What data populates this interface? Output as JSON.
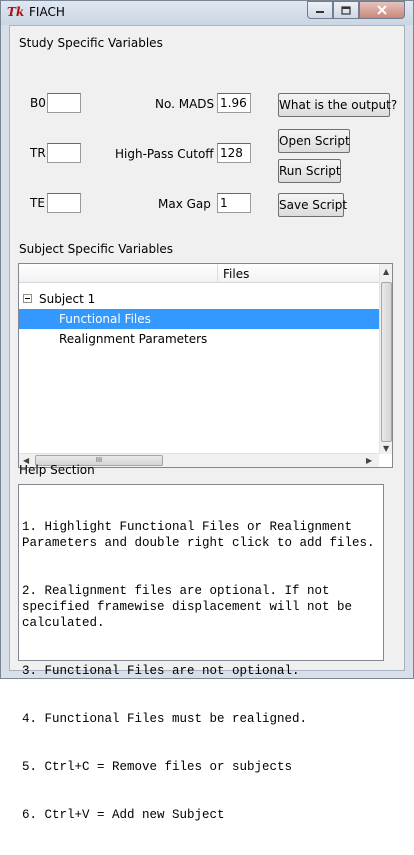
{
  "window": {
    "icon_text": "Tk",
    "title": "FIACH"
  },
  "study": {
    "section_label": "Study Specific Variables",
    "b0_label": "B0",
    "b0_value": "",
    "tr_label": "TR",
    "tr_value": "",
    "te_label": "TE",
    "te_value": "",
    "mads_label": "No. MADS",
    "mads_value": "1.96",
    "highpass_label": "High-Pass Cutoff",
    "highpass_value": "128",
    "maxgap_label": "Max Gap",
    "maxgap_value": "1"
  },
  "buttons": {
    "what_output": "What is the output?",
    "open_script": "Open Script",
    "run_script": "Run Script",
    "save_script": "Save Script"
  },
  "subject": {
    "section_label": "Subject Specific Variables",
    "column_header": "Files",
    "rows": [
      {
        "label": "Subject 1"
      },
      {
        "label": "Functional Files"
      },
      {
        "label": "Realignment Parameters"
      }
    ],
    "scroll_grip": "III"
  },
  "help": {
    "section_label": "Help Section",
    "lines": [
      "1. Highlight Functional Files or Realignment Parameters and double right click to add files.",
      "2. Realignment files are optional. If not specified framewise displacement will not be calculated.",
      "3. Functional Files are not optional.",
      "4. Functional Files must be realigned.",
      "5. Ctrl+C = Remove files or subjects",
      "6. Ctrl+V = Add new Subject"
    ]
  },
  "colors": {
    "selection": "#3399ff",
    "window_frame": "#d8dfe8",
    "client_bg": "#f0f0f0"
  },
  "icons": [
    "minimize-icon",
    "maximize-icon",
    "close-icon",
    "collapse-icon",
    "scroll-left-icon",
    "scroll-right-icon",
    "scroll-up-icon",
    "scroll-down-icon"
  ]
}
